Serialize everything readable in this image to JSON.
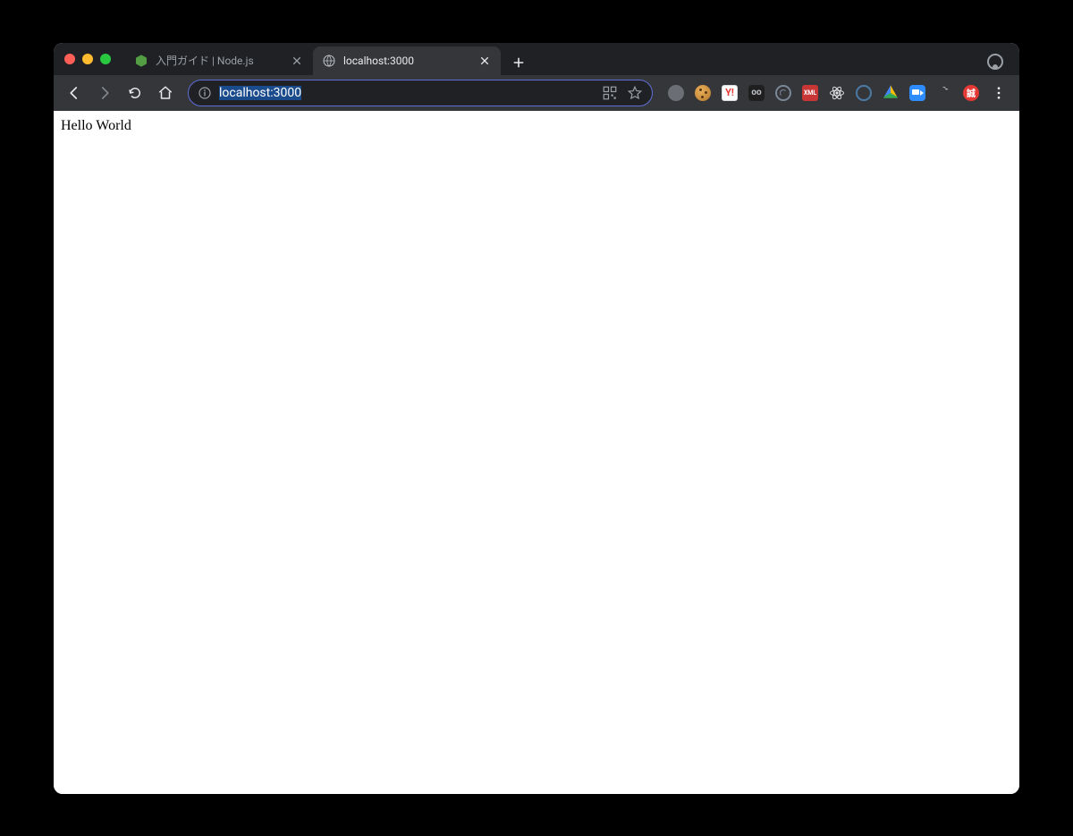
{
  "tabs": [
    {
      "title": "入門ガイド | Node.js",
      "active": false
    },
    {
      "title": "localhost:3000",
      "active": true
    }
  ],
  "address_bar": {
    "url": "localhost:3000"
  },
  "page": {
    "body_text": "Hello World"
  },
  "ext_labels": {
    "y": "Y!",
    "dark_sq": "oo",
    "red_pill": "XML",
    "red_circle": "誠"
  }
}
